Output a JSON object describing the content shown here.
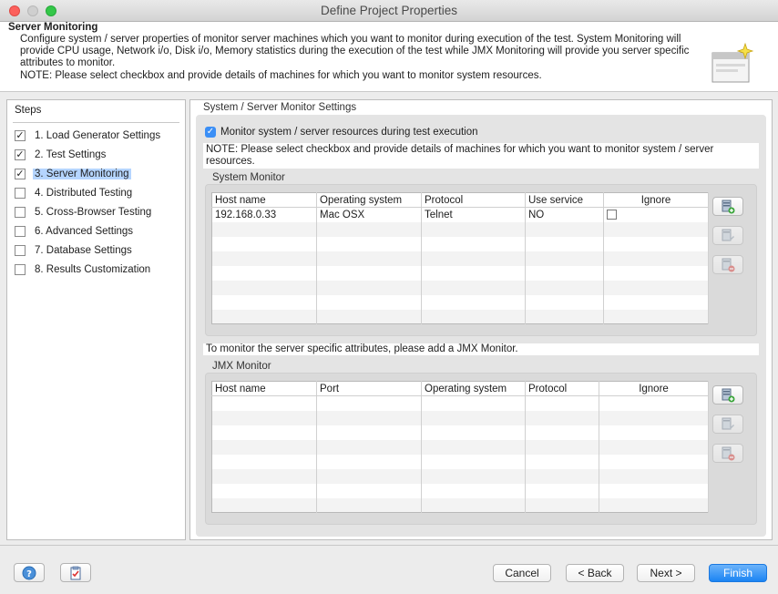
{
  "window": {
    "title": "Define Project Properties"
  },
  "header": {
    "title": "Server Monitoring",
    "description": "Configure system / server properties of monitor server machines which you want to monitor during execution of the test. System Monitoring will provide CPU usage, Network i/o, Disk i/o, Memory statistics during the execution of the test while JMX Monitoring will provide you server specific attributes to monitor.",
    "note": "NOTE: Please select checkbox and provide details of machines for which you want to monitor system resources."
  },
  "steps": {
    "title": "Steps",
    "items": [
      {
        "label": "1. Load Generator Settings",
        "checked": true
      },
      {
        "label": "2. Test Settings",
        "checked": true
      },
      {
        "label": "3. Server Monitoring",
        "checked": true,
        "selected": true
      },
      {
        "label": "4. Distributed Testing",
        "checked": false
      },
      {
        "label": "5. Cross-Browser Testing",
        "checked": false
      },
      {
        "label": "6. Advanced Settings",
        "checked": false
      },
      {
        "label": "7. Database Settings",
        "checked": false
      },
      {
        "label": "8. Results Customization",
        "checked": false
      }
    ]
  },
  "main": {
    "section_title": "System / Server Monitor Settings",
    "monitor_checkbox_label": "Monitor system / server resources during test execution",
    "note": "NOTE: Please select checkbox and provide details of machines for which you want to monitor system / server resources.",
    "system_monitor": {
      "title": "System Monitor",
      "columns": [
        "Host name",
        "Operating system",
        "Protocol",
        "Use service",
        "Ignore"
      ],
      "rows": [
        [
          "192.168.0.33",
          "Mac OSX",
          "Telnet",
          "NO",
          ""
        ]
      ]
    },
    "jmx_note": "To monitor the server specific attributes, please add a JMX Monitor.",
    "jmx_monitor": {
      "title": "JMX Monitor",
      "columns": [
        "Host name",
        "Port",
        "Operating system",
        "Protocol",
        "Ignore"
      ],
      "rows": []
    }
  },
  "footer": {
    "cancel": "Cancel",
    "back": "< Back",
    "next": "Next >",
    "finish": "Finish"
  },
  "colors": {
    "accent": "#1b84f3",
    "selection": "#b5d5ff"
  }
}
